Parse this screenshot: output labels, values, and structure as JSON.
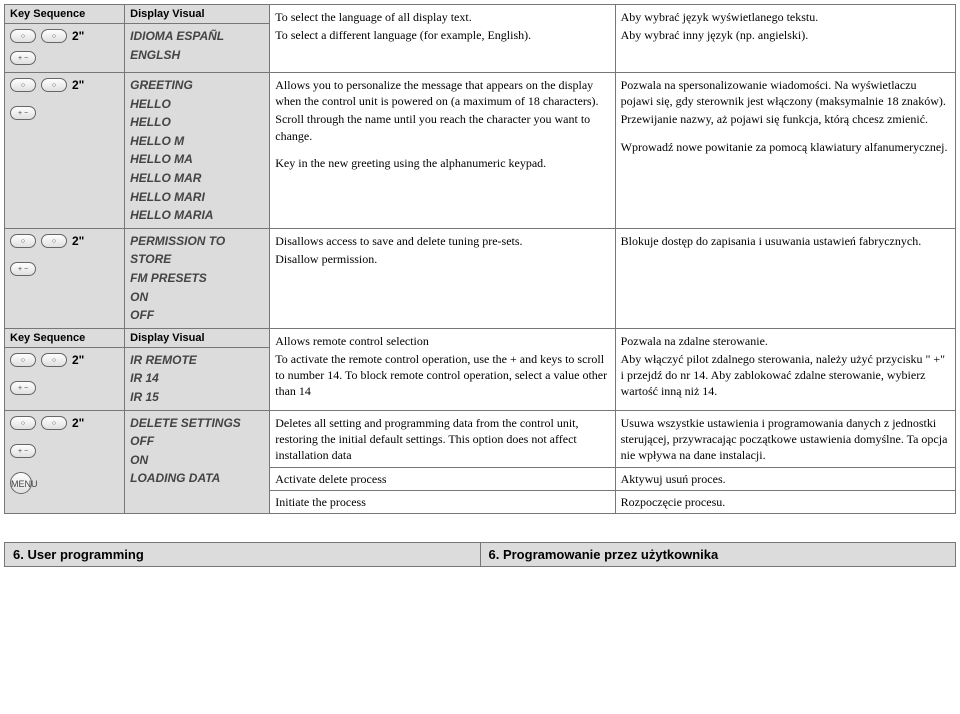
{
  "headers": {
    "key_sequence": "Key Sequence",
    "display_visual": "Display Visual"
  },
  "rows": [
    {
      "dv": [
        "IDIOMA ESPAÑL",
        "ENGLSH"
      ],
      "en": [
        "To select the language of all display text.",
        "To select a different language (for example, English)."
      ],
      "pl": [
        "Aby wybrać język wyświetlanego tekstu.",
        "Aby wybrać inny język (np. angielski)."
      ]
    },
    {
      "dv": [
        "GREETING",
        "HELLO",
        "HELLO",
        "HELLO M",
        "HELLO MA",
        "HELLO MAR",
        "HELLO MARI",
        "HELLO MARIA"
      ],
      "en": [
        "Allows you to personalize the message that appears on the display when the control unit is powered on (a maximum of 18 characters).",
        "Scroll through the name until you reach the character you want to change."
      ],
      "en2": "Key in the new greeting using the alphanumeric keypad.",
      "pl": [
        "Pozwala na spersonalizowanie wiadomości. Na wyświetlaczu pojawi się, gdy sterownik jest włączony (maksymalnie 18 znaków).",
        "Przewijanie nazwy, aż pojawi się funkcja, którą chcesz zmienić."
      ],
      "pl2": "Wprowadź nowe powitanie za pomocą klawiatury alfanumerycznej."
    },
    {
      "dv": [
        "PERMISSION TO STORE",
        "FM PRESETS",
        "ON",
        "OFF"
      ],
      "en": [
        "Disallows access to save and delete tuning pre-sets.",
        "Disallow permission."
      ],
      "pl": [
        "Blokuje dostęp do zapisania i usuwania ustawień fabrycznych."
      ]
    },
    {
      "dv": [
        "IR REMOTE",
        "IR 14",
        "IR 15"
      ],
      "en": [
        "Allows remote control selection",
        "To activate the remote control operation, use the + and keys to scroll to number 14. To block remote control operation, select a value other than 14"
      ],
      "pl": [
        "Pozwala na zdalne sterowanie.",
        "Aby włączyć pilot zdalnego sterowania, należy użyć przycisku \" +\" i przejdź do nr 14. Aby zablokować zdalne sterowanie, wybierz wartość inną niż 14."
      ]
    },
    {
      "dv": [
        "DELETE SETTINGS",
        "OFF",
        "ON",
        "LOADING DATA"
      ],
      "en": [
        "Deletes all setting and programming data from the control unit, restoring the initial default settings. This option does not affect installation data"
      ],
      "en2": "Activate delete process",
      "en3": "Initiate the process",
      "pl": [
        "Usuwa wszystkie ustawienia i programowania danych z jednostki sterującej, przywracając początkowe ustawienia domyślne. Ta opcja nie wpływa na dane instalacji."
      ],
      "pl2": "Aktywuj usuń proces.",
      "pl3": "Rozpoczęcie procesu."
    }
  ],
  "ks": {
    "sec2": "2\"",
    "menu": "MENU",
    "plusminus": "+ / −",
    "plus": "+",
    "minus": "−"
  },
  "footer": {
    "left": "6. User programming",
    "right": "6. Programowanie przez użytkownika"
  }
}
